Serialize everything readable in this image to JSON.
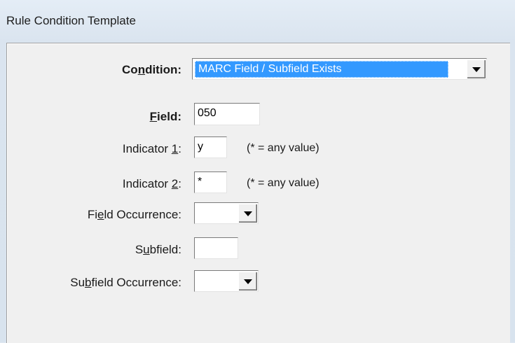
{
  "window": {
    "title": "Rule Condition Template"
  },
  "form": {
    "condition": {
      "label_pre": "Co",
      "label_key": "n",
      "label_post": "dition:",
      "value": "MARC Field / Subfield Exists"
    },
    "field": {
      "label_key": "F",
      "label_post": "ield:",
      "value": "050"
    },
    "indicator1": {
      "label_pre": "Indicator ",
      "label_key": "1",
      "label_post": ":",
      "value": "y",
      "hint": "(* = any value)"
    },
    "indicator2": {
      "label_pre": "Indicator ",
      "label_key": "2",
      "label_post": ":",
      "value": "*",
      "hint": "(* = any value)"
    },
    "field_occurrence": {
      "label_pre": "Fi",
      "label_key": "e",
      "label_post": "ld Occurrence:",
      "value": ""
    },
    "subfield": {
      "label_pre": "S",
      "label_key": "u",
      "label_post": "bfield:",
      "value": ""
    },
    "subfield_occurrence": {
      "label_pre": "Su",
      "label_key": "b",
      "label_post": "field Occurrence:",
      "value": ""
    }
  }
}
